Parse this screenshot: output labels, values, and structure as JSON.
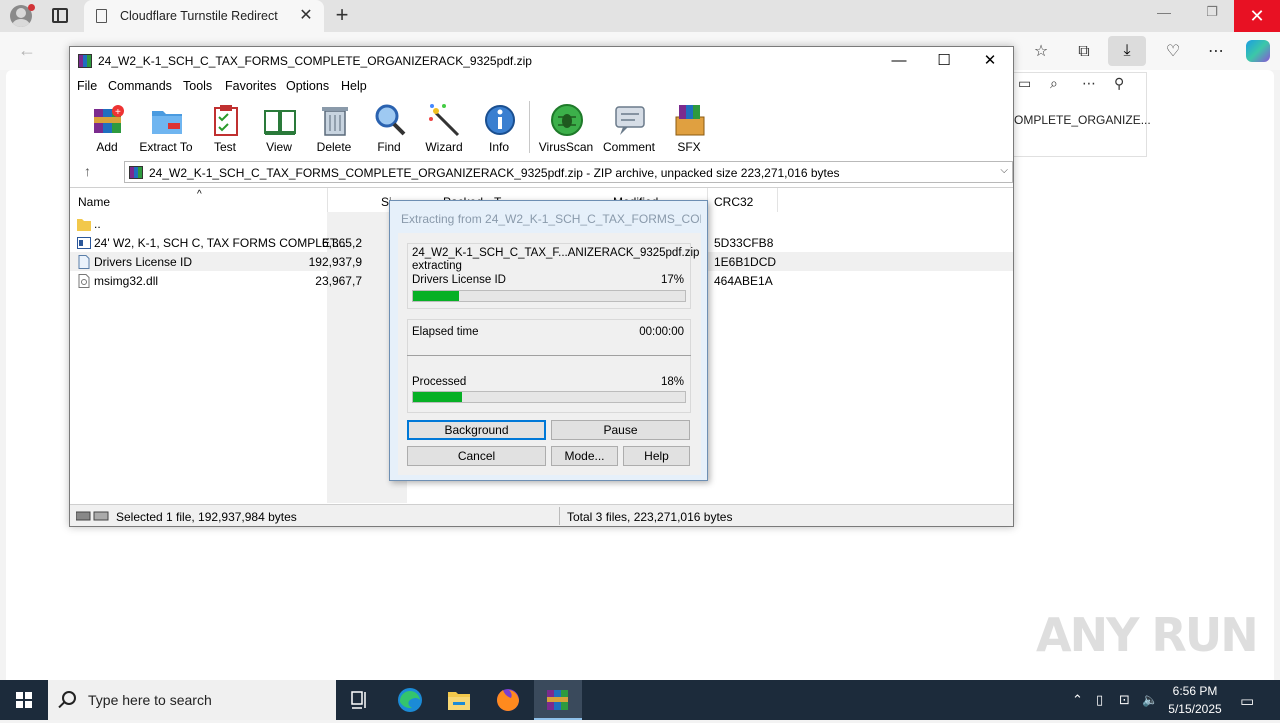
{
  "browser": {
    "tab_title": "Cloudflare Turnstile Redirect",
    "tab_close": "✕",
    "new_tab": "+",
    "side_panel_text": "OMPLETE_ORGANIZE..."
  },
  "winrar": {
    "title": "24_W2_K-1_SCH_C_TAX_FORMS_COMPLETE_ORGANIZERACK_9325pdf.zip",
    "menu": [
      "File",
      "Commands",
      "Tools",
      "Favorites",
      "Options",
      "Help"
    ],
    "toolbar": [
      "Add",
      "Extract To",
      "Test",
      "View",
      "Delete",
      "Find",
      "Wizard",
      "Info",
      "VirusScan",
      "Comment",
      "SFX"
    ],
    "address": "24_W2_K-1_SCH_C_TAX_FORMS_COMPLETE_ORGANIZERACK_9325pdf.zip - ZIP archive, unpacked size 223,271,016 bytes",
    "columns": {
      "name": "Name",
      "size": "Si",
      "packed": "Packed",
      "type": "T",
      "modified": "Modified",
      "crc": "CRC32"
    },
    "rows": [
      {
        "name": "..",
        "size": "",
        "crc": ""
      },
      {
        "name": "24' W2, K-1, SCH C, TAX FORMS COMPLET...",
        "size": "6,365,2",
        "crc": "5D33CFB8"
      },
      {
        "name": "Drivers License ID",
        "size": "192,937,9",
        "crc": "1E6B1DCD"
      },
      {
        "name": "msimg32.dll",
        "size": "23,967,7",
        "crc": "464ABE1A"
      }
    ],
    "status_left": "Selected 1 file, 192,937,984 bytes",
    "status_right": "Total 3 files, 223,271,016 bytes"
  },
  "dialog": {
    "title": "Extracting from 24_W2_K-1_SCH_C_TAX_FORMS_COM...",
    "archive": "24_W2_K-1_SCH_C_TAX_F...ANIZERACK_9325pdf.zip",
    "action": "extracting",
    "file": "Drivers License ID",
    "file_percent": "17%",
    "file_progress": 17,
    "elapsed_label": "Elapsed time",
    "elapsed_value": "00:00:00",
    "processed_label": "Processed",
    "processed_percent": "18%",
    "processed_progress": 18,
    "buttons": {
      "background": "Background",
      "pause": "Pause",
      "cancel": "Cancel",
      "mode": "Mode...",
      "help": "Help"
    }
  },
  "taskbar": {
    "search_placeholder": "Type here to search",
    "time": "6:56 PM",
    "date": "5/15/2025"
  },
  "watermark": "ANY RUN"
}
